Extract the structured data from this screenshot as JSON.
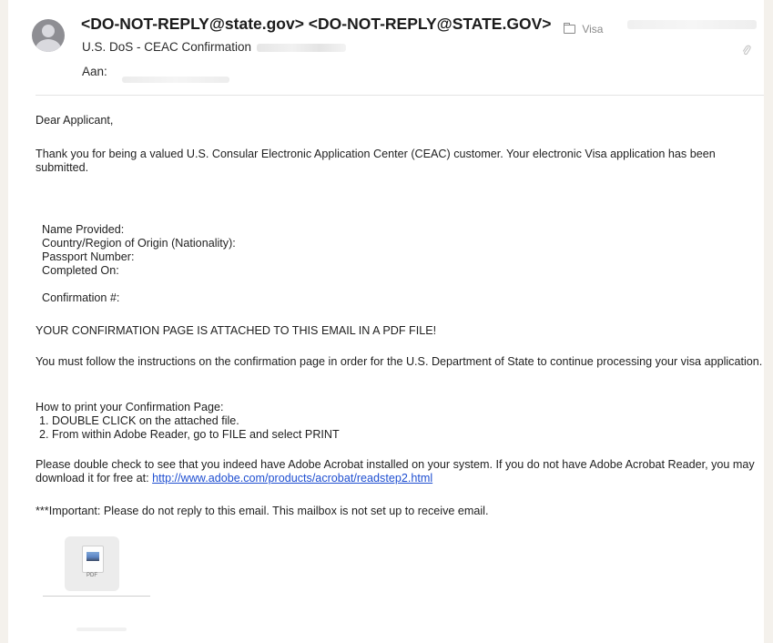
{
  "header": {
    "sender": "<DO-NOT-REPLY@state.gov> <DO-NOT-REPLY@STATE.GOV>",
    "subject": "U.S. DoS - CEAC Confirmation",
    "to_label": "Aan:",
    "folder": "Visa"
  },
  "icons": {
    "avatar": "person-avatar-icon",
    "folder": "folder-icon",
    "attachment_indicator": "paperclip-icon",
    "attachment": "pdf-file-icon"
  },
  "body": {
    "greeting": "Dear Applicant,",
    "intro": "Thank you for being a valued U.S. Consular Electronic Application Center (CEAC) customer. Your electronic Visa application has been submitted.",
    "details": {
      "name_provided": "Name Provided:",
      "country_region": "Country/Region of Origin (Nationality):",
      "passport_number": "Passport Number:",
      "completed_on": "Completed On:",
      "confirmation_number": "Confirmation #:"
    },
    "attached_notice": "YOUR CONFIRMATION PAGE IS ATTACHED TO THIS EMAIL IN A PDF FILE!",
    "follow_instructions": "You must follow the instructions on the confirmation page in order for the U.S. Department of State to continue processing your visa application.",
    "print_heading": "How to print your Confirmation Page:",
    "print_steps": [
      "1. DOUBLE CLICK on the attached file.",
      "2. From within Adobe Reader, go to FILE and select PRINT"
    ],
    "acrobat_text": "Please double check to see that you indeed have Adobe Acrobat installed on your system. If you do not have Adobe Acrobat Reader, you may download it for free at:",
    "acrobat_link": "http://www.adobe.com/products/acrobat/readstep2.html",
    "important": "***Important: Please do not reply to this email.  This mailbox is not set up to receive email."
  },
  "attachment": {
    "type_label": "PDF"
  },
  "colors": {
    "page_background": "#f4f1ec",
    "mail_background": "#ffffff",
    "link": "#1f4fd1",
    "avatar": "#8e8e93"
  }
}
